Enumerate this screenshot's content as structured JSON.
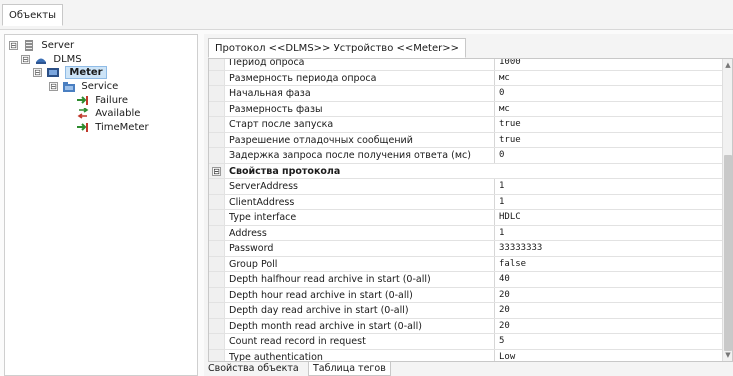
{
  "top_tab": "Объекты",
  "tree": {
    "server": "Server",
    "dlms": "DLMS",
    "meter": "Meter",
    "service": "Service",
    "failure": "Failure",
    "available": "Available",
    "timemeter": "TimeMeter"
  },
  "prop_tab": "Протокол <<DLMS>> Устройство <<Meter>>",
  "rows": [
    {
      "name": "Период опроса",
      "value": "1000"
    },
    {
      "name": "Размерность периода опроса",
      "value": "мс"
    },
    {
      "name": "Начальная фаза",
      "value": "0"
    },
    {
      "name": "Размерность фазы",
      "value": "мс"
    },
    {
      "name": "Старт после запуска",
      "value": "true"
    },
    {
      "name": "Разрешение отладочных сообщений",
      "value": "true"
    },
    {
      "name": "Задержка запроса после получения ответа (мс)",
      "value": "0"
    },
    {
      "name": "Свойства протокола",
      "value": "",
      "category": true
    },
    {
      "name": "ServerAddress",
      "value": "1"
    },
    {
      "name": "ClientAddress",
      "value": "1"
    },
    {
      "name": "Type interface",
      "value": "HDLC"
    },
    {
      "name": "Address",
      "value": "1"
    },
    {
      "name": "Password",
      "value": "33333333"
    },
    {
      "name": "Group Poll",
      "value": "false"
    },
    {
      "name": "Depth halfhour read archive in start (0-all)",
      "value": "40"
    },
    {
      "name": "Depth hour read archive in start (0-all)",
      "value": "20"
    },
    {
      "name": "Depth day read archive in start (0-all)",
      "value": "20"
    },
    {
      "name": "Depth month read archive in start (0-all)",
      "value": "20"
    },
    {
      "name": "Count read record in request",
      "value": "5"
    },
    {
      "name": "Type authentication",
      "value": "Low"
    }
  ],
  "bottom_tabs": [
    "Свойства объекта",
    "Таблица тегов"
  ],
  "icons": {
    "expand": "⊟",
    "collapse": "⊟",
    "scroll_up": "▲",
    "scroll_down": "▼"
  }
}
